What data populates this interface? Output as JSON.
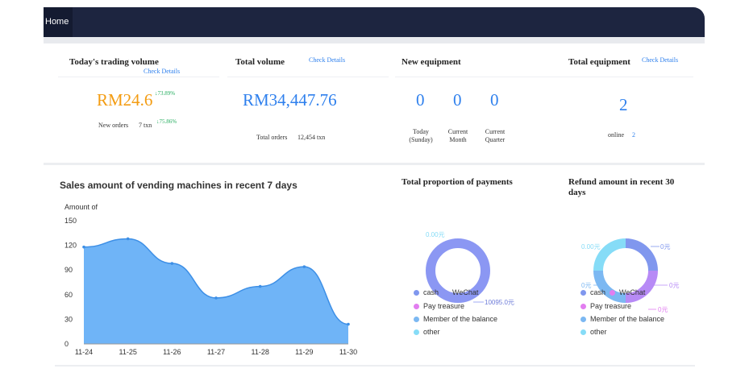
{
  "nav": {
    "home_label": "Home"
  },
  "cards": {
    "today": {
      "title": "Today's trading volume",
      "link": "Check Details",
      "amount": "RM24.6",
      "amount_change": "↓73.89%",
      "orders_label": "New orders",
      "orders_value": "7 txn",
      "orders_change": "↓75.86%"
    },
    "total_volume": {
      "title": "Total volume",
      "link": "Check Details",
      "amount": "RM34,447.76",
      "orders_label": "Total orders",
      "orders_value": "12,454 txn"
    },
    "new_equipment": {
      "title": "New equipment",
      "values": [
        "0",
        "0",
        "0"
      ],
      "labels": [
        "Today (Sunday)",
        "Current Month",
        "Current Quarter"
      ]
    },
    "total_equipment": {
      "title": "Total equipment",
      "link": "Check Details",
      "value": "2",
      "online_label": "online",
      "online_value": "2"
    }
  },
  "sales": {
    "title": "Sales amount of vending machines in recent 7 days",
    "color": "#6fb4f7",
    "line_color": "#3d8fe6"
  },
  "chart_data": [
    {
      "type": "area",
      "title": "Sales amount of vending machines in recent 7 days",
      "ylabel": "Amount of",
      "categories": [
        "11-24",
        "11-25",
        "11-26",
        "11-27",
        "11-28",
        "11-29",
        "11-30"
      ],
      "values": [
        118,
        128,
        98,
        56,
        70,
        94,
        24
      ],
      "yticks": [
        0,
        30,
        60,
        90,
        120,
        150
      ],
      "ylim": [
        0,
        150
      ]
    },
    {
      "type": "pie",
      "title": "Total proportion of payments",
      "categories": [
        "cash",
        "WeChat",
        "Pay treasure",
        "Member of the balance",
        "other"
      ],
      "values": [
        0,
        10095,
        0,
        0,
        0
      ],
      "value_labels": [
        "0.00元",
        "10095.0元"
      ],
      "legend": "bottom",
      "colors": [
        "#8097ee",
        "#8b97f3",
        "#e27ef0",
        "#7cb8f2",
        "#86dcf7"
      ]
    },
    {
      "type": "pie",
      "title": "Refund amount in recent 30 days",
      "categories": [
        "cash",
        "WeChat",
        "Pay treasure",
        "Member of the balance",
        "other"
      ],
      "values": [
        0,
        0,
        0,
        0,
        0
      ],
      "value_labels": [
        "0.00元",
        "0元",
        "0元",
        "0元",
        "0元"
      ],
      "legend": "bottom",
      "colors": [
        "#8097ee",
        "#b78af6",
        "#e27ef0",
        "#7cb8f2",
        "#86dcf7"
      ]
    }
  ]
}
